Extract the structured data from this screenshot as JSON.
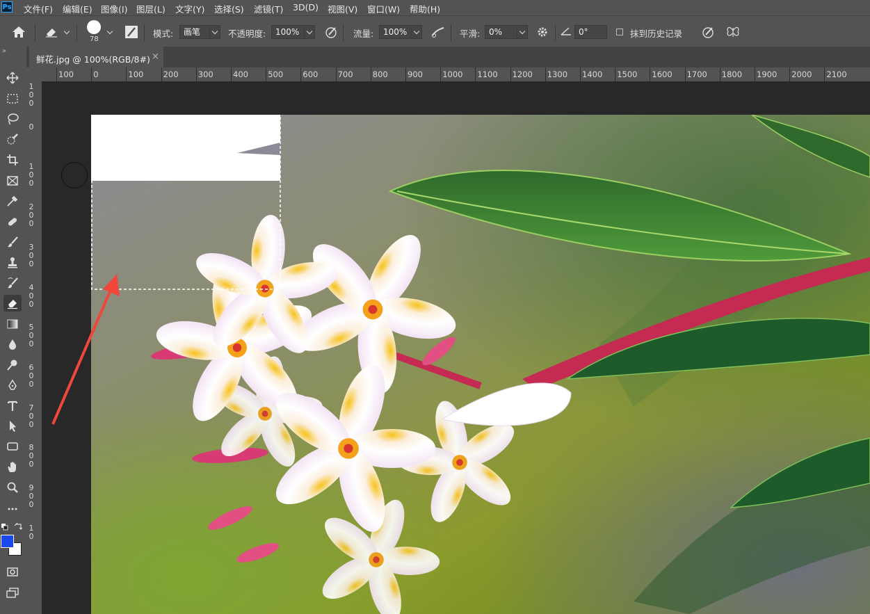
{
  "app": {
    "logo": "Ps"
  },
  "menu": [
    "文件(F)",
    "编辑(E)",
    "图像(I)",
    "图层(L)",
    "文字(Y)",
    "选择(S)",
    "滤镜(T)",
    "3D(D)",
    "视图(V)",
    "窗口(W)",
    "帮助(H)"
  ],
  "options": {
    "brush_size": "78",
    "mode_label": "模式:",
    "mode_value": "画笔",
    "opacity_label": "不透明度:",
    "opacity_value": "100%",
    "flow_label": "流量:",
    "flow_value": "100%",
    "smoothing_label": "平滑:",
    "smoothing_value": "0%",
    "angle_value": "0°",
    "erase_to_history_label": "抹到历史记录",
    "erase_to_history_checked": false
  },
  "document": {
    "tab_title": "鲜花.jpg @ 100%(RGB/8#)",
    "close": "×"
  },
  "ruler": {
    "h_labels": [
      "100",
      "0",
      "100",
      "200",
      "300",
      "400",
      "500",
      "600",
      "700",
      "800",
      "900",
      "1000",
      "1100",
      "1200",
      "1300",
      "1400",
      "1500",
      "1600",
      "1700",
      "1800",
      "1900",
      "2000",
      "2100"
    ],
    "v_labels": [
      [
        "1",
        "0",
        "0"
      ],
      [
        "0"
      ],
      [
        "1",
        "0",
        "0"
      ],
      [
        "2",
        "0",
        "0"
      ],
      [
        "3",
        "0",
        "0"
      ],
      [
        "4",
        "0",
        "0"
      ],
      [
        "5",
        "0",
        "0"
      ],
      [
        "6",
        "0",
        "0"
      ],
      [
        "7",
        "0",
        "0"
      ],
      [
        "8",
        "0",
        "0"
      ],
      [
        "9",
        "0",
        "0"
      ],
      [
        "1",
        "0"
      ]
    ]
  },
  "toolbar": {
    "collapse": "»",
    "tools": [
      "move-tool",
      "marquee-tool",
      "lasso-tool",
      "quick-selection-tool",
      "crop-tool",
      "frame-tool",
      "eyedropper-tool",
      "healing-brush-tool",
      "brush-tool",
      "clone-stamp-tool",
      "history-brush-tool",
      "eraser-tool",
      "gradient-tool",
      "blur-tool",
      "dodge-tool",
      "pen-tool",
      "type-tool",
      "path-selection-tool",
      "rectangle-tool",
      "hand-tool",
      "zoom-tool",
      "more-tools"
    ],
    "active_tool": "eraser-tool",
    "foreground_color": "#1b49f0",
    "background_color": "#ffffff"
  },
  "colors": {
    "ui_panel": "#535353",
    "canvas_bg": "#282828",
    "annotation_arrow": "#f0473a"
  }
}
